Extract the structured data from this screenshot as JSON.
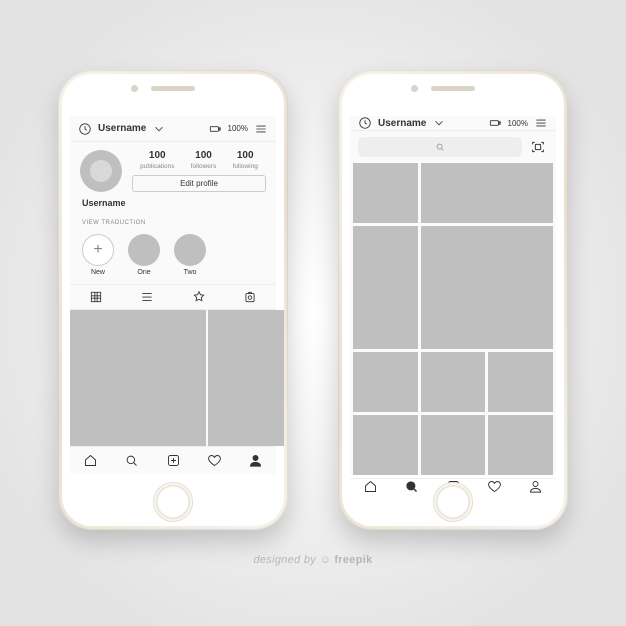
{
  "header": {
    "username": "Username",
    "battery": "100%"
  },
  "profile": {
    "stats": [
      {
        "num": "100",
        "label": "publications"
      },
      {
        "num": "100",
        "label": "followers"
      },
      {
        "num": "100",
        "label": "following"
      }
    ],
    "edit_label": "Edit profile",
    "bio_name": "Username",
    "view_traduction": "VIEW TRADUCTION"
  },
  "highlights": [
    {
      "label": "New",
      "is_new": true
    },
    {
      "label": "One"
    },
    {
      "label": "Two"
    }
  ],
  "credit": "designed by ",
  "credit_brand": "freepik"
}
